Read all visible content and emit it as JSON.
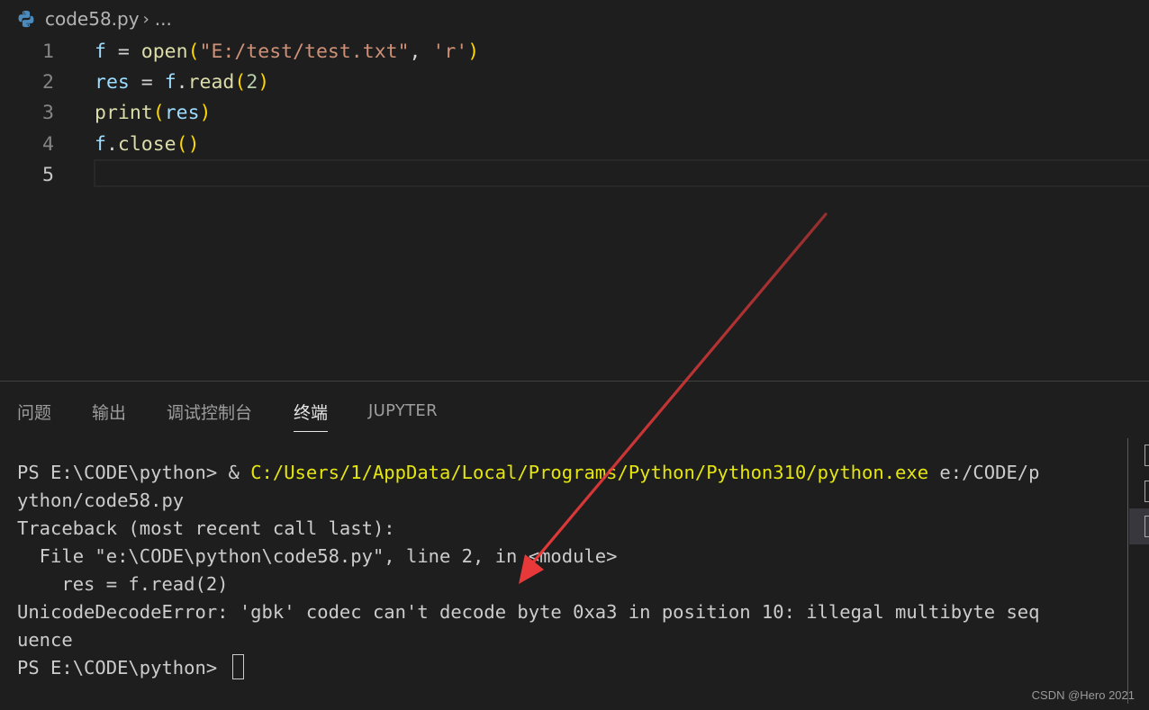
{
  "breadcrumb": {
    "icon": "python-file-icon",
    "file_name": "code58.py",
    "separator": "›",
    "ellipsis": "..."
  },
  "editor": {
    "lines": [
      {
        "number": "1",
        "tokens": [
          {
            "t": "f",
            "c": "var"
          },
          {
            "t": " = ",
            "c": "op"
          },
          {
            "t": "open",
            "c": "fn"
          },
          {
            "t": "(",
            "c": "par"
          },
          {
            "t": "\"E:/test/test.txt\"",
            "c": "str"
          },
          {
            "t": ", ",
            "c": "op"
          },
          {
            "t": "'r'",
            "c": "str"
          },
          {
            "t": ")",
            "c": "par"
          }
        ]
      },
      {
        "number": "2",
        "tokens": [
          {
            "t": "res",
            "c": "var"
          },
          {
            "t": " = ",
            "c": "op"
          },
          {
            "t": "f",
            "c": "var"
          },
          {
            "t": ".",
            "c": "op"
          },
          {
            "t": "read",
            "c": "fn"
          },
          {
            "t": "(",
            "c": "par"
          },
          {
            "t": "2",
            "c": "num"
          },
          {
            "t": ")",
            "c": "par"
          }
        ]
      },
      {
        "number": "3",
        "tokens": [
          {
            "t": "print",
            "c": "fn"
          },
          {
            "t": "(",
            "c": "par"
          },
          {
            "t": "res",
            "c": "var"
          },
          {
            "t": ")",
            "c": "par"
          }
        ]
      },
      {
        "number": "4",
        "tokens": [
          {
            "t": "f",
            "c": "var"
          },
          {
            "t": ".",
            "c": "op"
          },
          {
            "t": "close",
            "c": "fn"
          },
          {
            "t": "()",
            "c": "par"
          }
        ]
      },
      {
        "number": "5",
        "tokens": []
      }
    ]
  },
  "panel": {
    "tabs": [
      {
        "label": "问题",
        "active": false
      },
      {
        "label": "输出",
        "active": false
      },
      {
        "label": "调试控制台",
        "active": false
      },
      {
        "label": "终端",
        "active": true
      },
      {
        "label": "JUPYTER",
        "active": false
      }
    ]
  },
  "terminal": {
    "lines": [
      [
        {
          "t": "PS E:\\CODE\\python> & ",
          "c": "plain"
        },
        {
          "t": "C:/Users/1/AppData/Local/Programs/Python/Python310/python.exe",
          "c": "yellow"
        },
        {
          "t": " e:/CODE/p",
          "c": "plain"
        }
      ],
      [
        {
          "t": "ython/code58.py",
          "c": "plain"
        }
      ],
      [
        {
          "t": "Traceback (most recent call last):",
          "c": "plain"
        }
      ],
      [
        {
          "t": "  File \"e:\\CODE\\python\\code58.py\", line 2, in <module>",
          "c": "plain"
        }
      ],
      [
        {
          "t": "    res = f.read(2)",
          "c": "plain"
        }
      ],
      [
        {
          "t": "UnicodeDecodeError: 'gbk' codec can't decode byte 0xa3 in position 10: illegal multibyte seq",
          "c": "plain"
        }
      ],
      [
        {
          "t": "uence",
          "c": "plain"
        }
      ],
      [
        {
          "t": "PS E:\\CODE\\python> ",
          "c": "plain"
        }
      ]
    ]
  },
  "watermark": "CSDN @Hero 2021",
  "colors": {
    "background": "#1e1e1e",
    "annotation_arrow": "#e8393a",
    "terminal_path": "#e5e510",
    "active_tab": "#e7e7e7"
  }
}
